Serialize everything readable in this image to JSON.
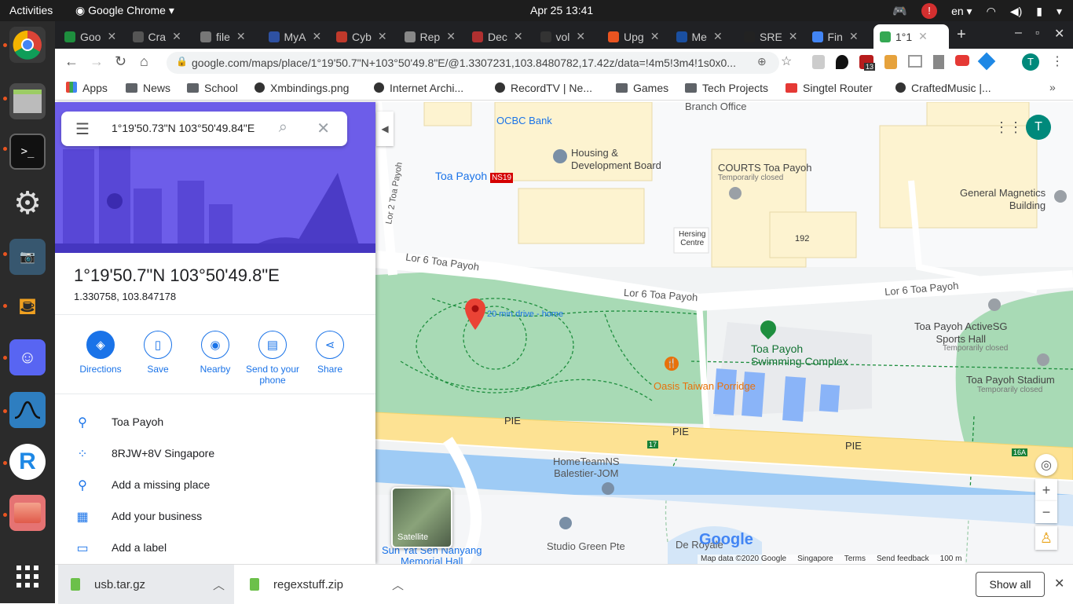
{
  "system": {
    "activities": "Activities",
    "app_name": "Google Chrome",
    "clock": "Apr 25  13:41",
    "lang": "en",
    "notification_count": "13"
  },
  "tabs": [
    {
      "label": "Goo",
      "color": "#1e8e3e"
    },
    {
      "label": "Cra",
      "color": "#555"
    },
    {
      "label": "file",
      "color": "#777"
    },
    {
      "label": "MyA",
      "color": "#2e51a2"
    },
    {
      "label": "Cyb",
      "color": "#c0392b"
    },
    {
      "label": "Rep",
      "color": "#888"
    },
    {
      "label": "Dec",
      "color": "#b03030"
    },
    {
      "label": "vol",
      "color": "#333"
    },
    {
      "label": "Upg",
      "color": "#e95420"
    },
    {
      "label": "Me",
      "color": "#1a4fa0"
    },
    {
      "label": "SRE",
      "color": "#222"
    },
    {
      "label": "Fin",
      "color": "#4285f4"
    },
    {
      "label": "1°1",
      "color": "#34a853"
    }
  ],
  "address": {
    "url": "google.com/maps/place/1°19'50.7\"N+103°50'49.8\"E/@1.3307231,103.8480782,17.42z/data=!4m5!3m4!1s0x0..."
  },
  "bookmarks": [
    "Apps",
    "News",
    "School",
    "Xmbindings.png",
    "Internet Archi...",
    "RecordTV | Ne...",
    "Games",
    "Tech Projects",
    "Singtel Router",
    "CraftedMusic |..."
  ],
  "search": {
    "query": "1°19'50.73\"N 103°50'49.84\"E"
  },
  "place": {
    "title": "1°19'50.7\"N 103°50'49.8\"E",
    "coords": "1.330758, 103.847178"
  },
  "actions": [
    {
      "label": "Directions",
      "icon": "directions-icon"
    },
    {
      "label": "Save",
      "icon": "bookmark-icon"
    },
    {
      "label": "Nearby",
      "icon": "nearby-icon"
    },
    {
      "label": "Send to your phone",
      "icon": "phone-icon"
    },
    {
      "label": "Share",
      "icon": "share-icon"
    }
  ],
  "info_rows": [
    {
      "label": "Toa Payoh",
      "icon": "pin-icon"
    },
    {
      "label": "8RJW+8V Singapore",
      "icon": "plus-code-icon"
    },
    {
      "label": "Add a missing place",
      "icon": "add-place-icon"
    },
    {
      "label": "Add your business",
      "icon": "business-icon"
    },
    {
      "label": "Add a label",
      "icon": "label-icon"
    }
  ],
  "map": {
    "labels": {
      "ocbc": "OCBC Bank",
      "branch": "Branch Office",
      "hdb": "Housing &\nDevelopment Board",
      "toa_payoh_mrt": "Toa Payoh",
      "mrt_code": "NS19",
      "courts": "COURTS Toa Payoh",
      "courts_status": "Temporarily closed",
      "general_magnetics": "General Magnetics\nBuilding",
      "hersing": "Hersing\nCentre",
      "block_192": "192",
      "lor6_a": "Lor 6 Toa Payoh",
      "lor6_b": "Lor 6 Toa Payoh",
      "lor6_c": "Lor 6 Toa Payoh",
      "lor2": "Lor 2 Toa Payoh",
      "drive": "20 min drive - home",
      "swimming": "Toa Payoh\nSwimming Complex",
      "activesg": "Toa Payoh ActiveSG\nSports Hall",
      "activesg_status": "Temporarily closed",
      "stadium": "Toa Payoh Stadium",
      "stadium_status": "Temporarily closed",
      "oasis": "Oasis Taiwan Porridge",
      "pie1": "PIE",
      "pie2": "PIE",
      "pie3": "PIE",
      "exit17": "17",
      "exit16a": "16A",
      "hometeam": "HomeTeamNS\nBalestier-JOM",
      "studio": "Studio Green Pte",
      "de_royale": "De Royale",
      "sun_yat": "Sun Yat Sen Nanyang\nMemorial Hall",
      "satellite": "Satellite"
    },
    "footer": {
      "data": "Map data ©2020 Google",
      "region": "Singapore",
      "terms": "Terms",
      "feedback": "Send feedback",
      "scale": "100 m"
    },
    "google_logo": "Google",
    "avatar": "T"
  },
  "downloads": {
    "items": [
      "usb.tar.gz",
      "regexstuff.zip"
    ],
    "show_all": "Show all"
  },
  "colors": {
    "accent": "#1a73e8",
    "park": "#a8dab5",
    "road": "#fde293",
    "water": "#9ecbf5",
    "hero": "#6d5de9",
    "pin": "#ea4335"
  }
}
